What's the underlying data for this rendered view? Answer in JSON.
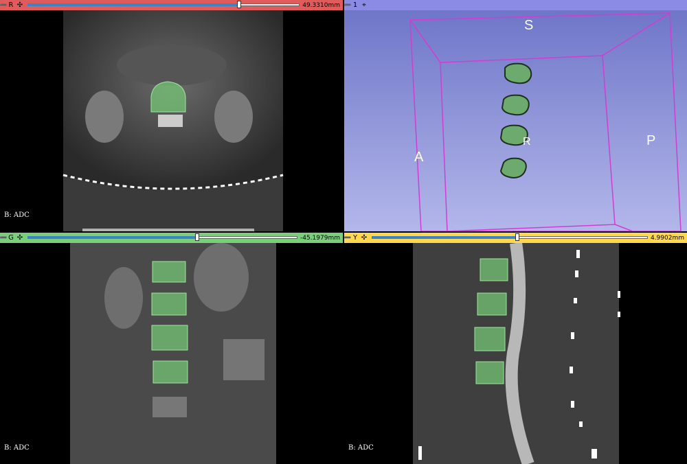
{
  "views": {
    "red": {
      "letter": "R",
      "offset": "49.3310mm",
      "slider_fraction": 0.77,
      "volume_label": "B: ADC",
      "color": "#e05c5c"
    },
    "threed": {
      "letter": "1",
      "color": "#8b8be6"
    },
    "green": {
      "letter": "G",
      "offset": "-45.1979mm",
      "slider_fraction": 0.62,
      "volume_label": "B: ADC",
      "color": "#7ad07a"
    },
    "yellow": {
      "letter": "Y",
      "offset": "4.9902mm",
      "slider_fraction": 0.52,
      "volume_label": "B: ADC",
      "color": "#ffd84f"
    }
  },
  "orientation": {
    "top": "S",
    "left": "A",
    "right": "P",
    "center": "R"
  },
  "icons": {
    "pin": "pin-icon",
    "crosshair": "crosshair-icon"
  }
}
